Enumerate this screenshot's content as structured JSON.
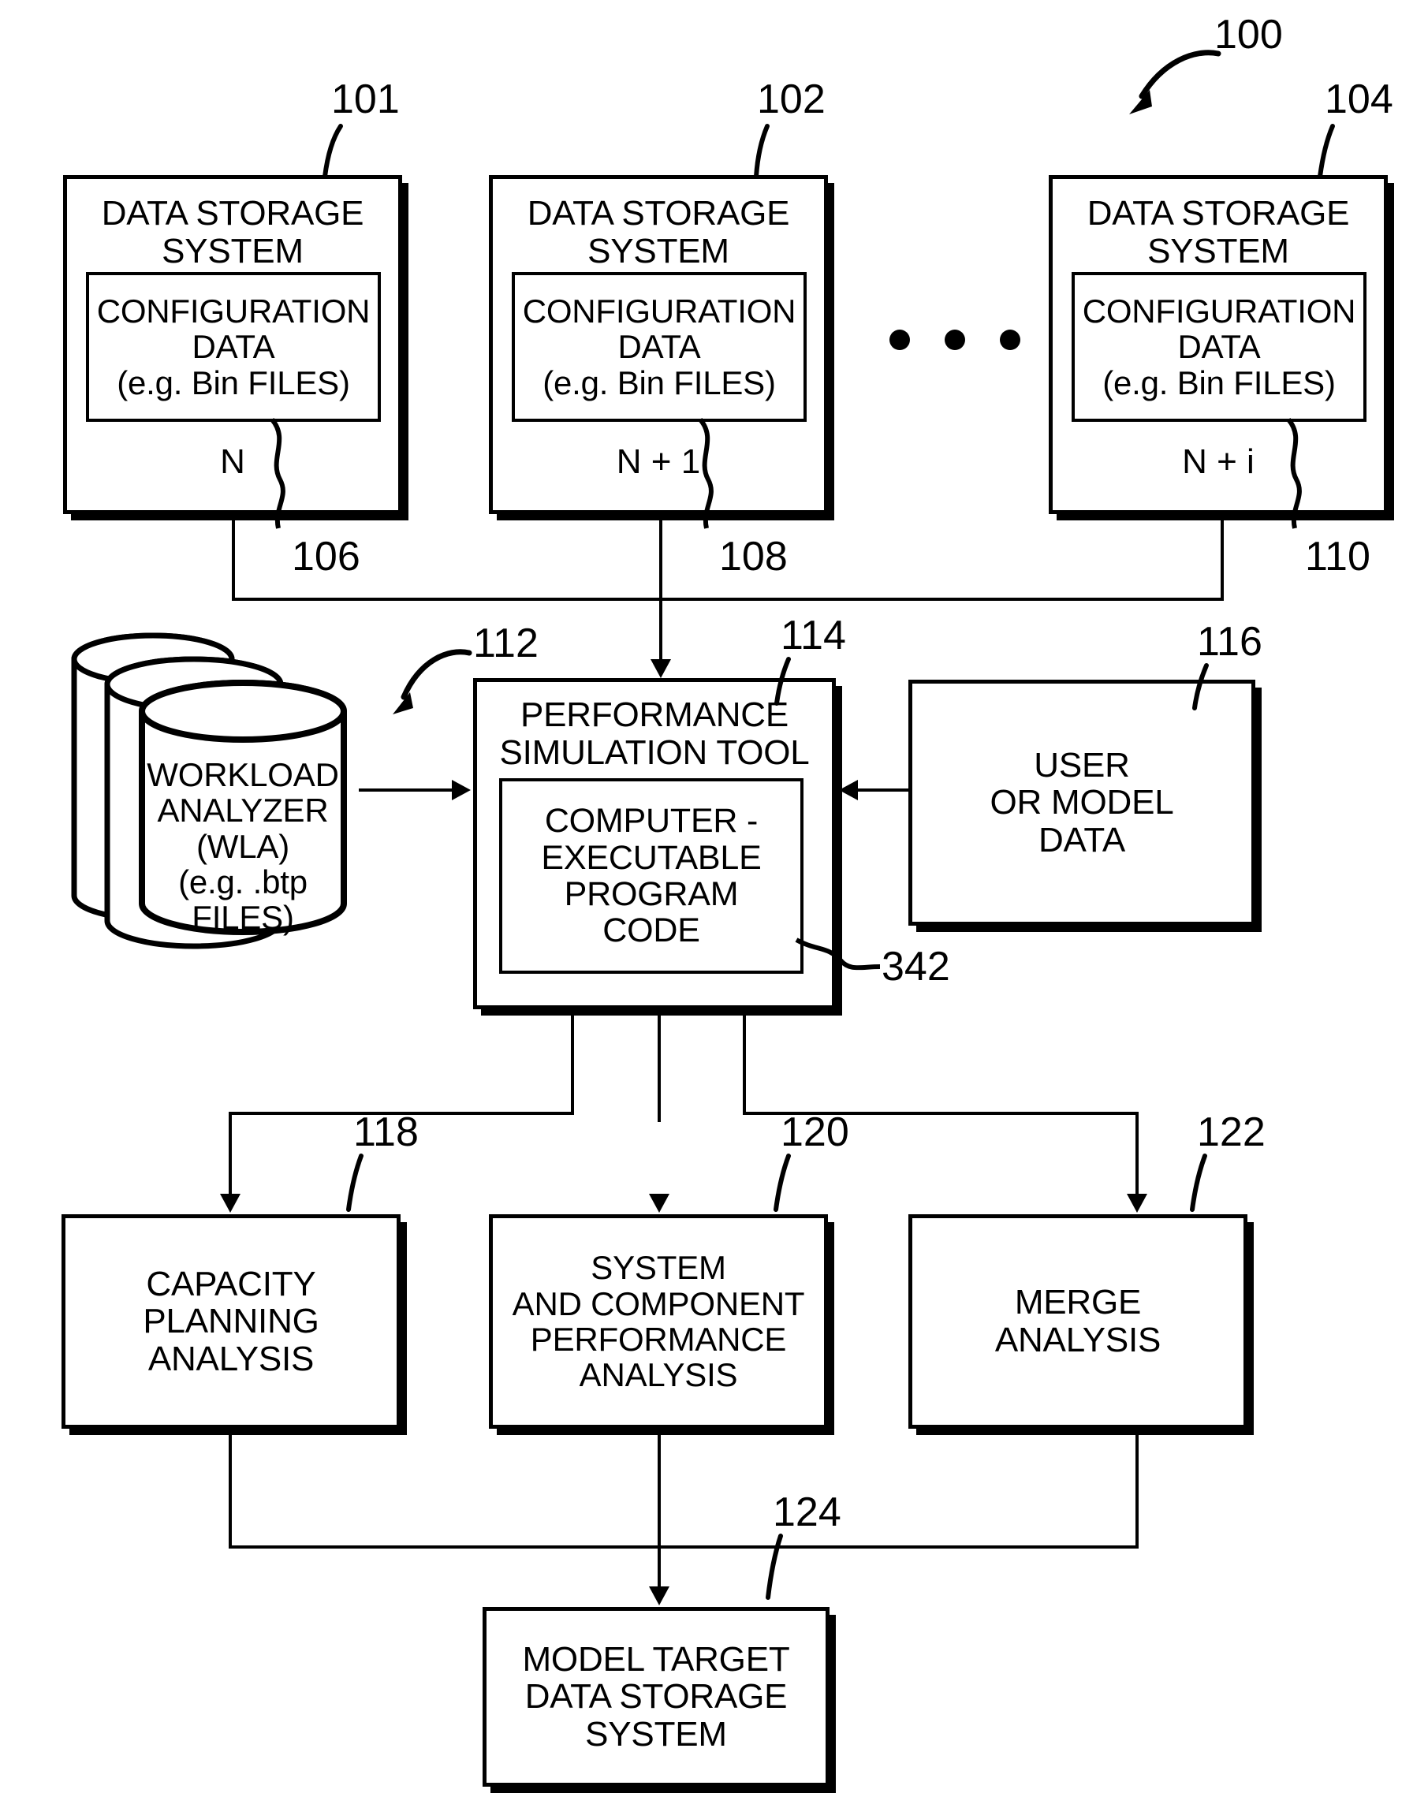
{
  "figure": {
    "system_ref": "100"
  },
  "storage_systems": [
    {
      "ref": "101",
      "title": "DATA STORAGE\nSYSTEM",
      "config_title": "CONFIGURATION\nDATA\n(e.g. Bin FILES)",
      "index": "N",
      "link_ref": "106"
    },
    {
      "ref": "102",
      "title": "DATA STORAGE\nSYSTEM",
      "config_title": "CONFIGURATION\nDATA\n(e.g. Bin FILES)",
      "index": "N + 1",
      "link_ref": "108"
    },
    {
      "ref": "104",
      "title": "DATA STORAGE\nSYSTEM",
      "config_title": "CONFIGURATION\nDATA\n(e.g. Bin FILES)",
      "index": "N + i",
      "link_ref": "110"
    }
  ],
  "workload_analyzer": {
    "ref": "112",
    "label": "WORKLOAD\nANALYZER\n(WLA)\n(e.g. .btp FILES)"
  },
  "simulation_tool": {
    "ref": "114",
    "label": "PERFORMANCE\nSIMULATION TOOL",
    "program_code": {
      "ref": "342",
      "label": "COMPUTER -\nEXECUTABLE\nPROGRAM\nCODE"
    }
  },
  "user_or_model_data": {
    "ref": "116",
    "label": "USER\nOR MODEL\nDATA"
  },
  "analyses": [
    {
      "ref": "118",
      "label": "CAPACITY\nPLANNING\nANALYSIS"
    },
    {
      "ref": "120",
      "label": "SYSTEM\nAND COMPONENT\nPERFORMANCE\nANALYSIS"
    },
    {
      "ref": "122",
      "label": "MERGE\nANALYSIS"
    }
  ],
  "model_target": {
    "ref": "124",
    "label": "MODEL TARGET\nDATA STORAGE\nSYSTEM"
  }
}
